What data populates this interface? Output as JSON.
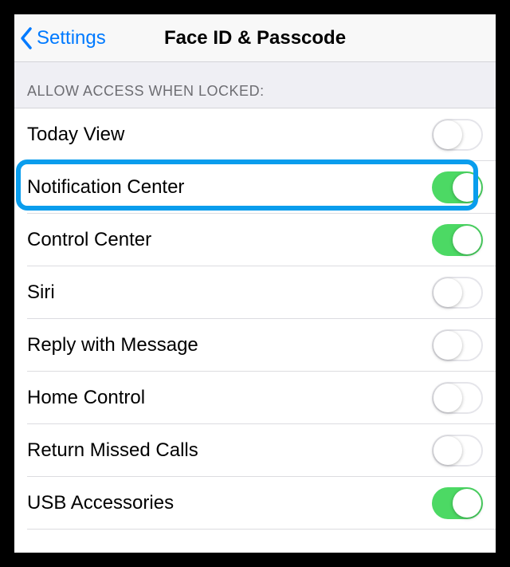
{
  "nav": {
    "back_label": "Settings",
    "title": "Face ID & Passcode"
  },
  "section": {
    "header": "ALLOW ACCESS WHEN LOCKED:"
  },
  "rows": [
    {
      "label": "Today View",
      "on": false,
      "name": "today-view"
    },
    {
      "label": "Notification Center",
      "on": true,
      "name": "notification-center",
      "highlighted": true
    },
    {
      "label": "Control Center",
      "on": true,
      "name": "control-center"
    },
    {
      "label": "Siri",
      "on": false,
      "name": "siri"
    },
    {
      "label": "Reply with Message",
      "on": false,
      "name": "reply-with-message"
    },
    {
      "label": "Home Control",
      "on": false,
      "name": "home-control"
    },
    {
      "label": "Return Missed Calls",
      "on": false,
      "name": "return-missed-calls"
    },
    {
      "label": "USB Accessories",
      "on": true,
      "name": "usb-accessories"
    }
  ],
  "colors": {
    "tint": "#007aff",
    "toggle_on": "#4cd964",
    "highlight": "#0a9ded"
  }
}
